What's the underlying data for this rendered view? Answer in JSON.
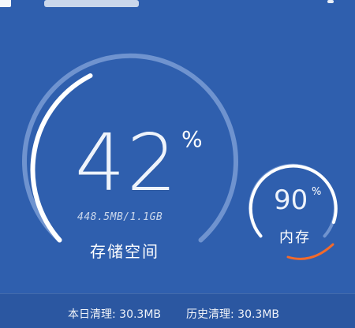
{
  "topbar": {
    "title": "",
    "menu_icon": "more-icon"
  },
  "storage": {
    "percent_value": "42",
    "percent_sign": "%",
    "usage_text": "448.5MB/1.1GB",
    "label": "存储空间",
    "used_fraction": 0.42
  },
  "memory": {
    "percent_value": "90",
    "percent_sign": "%",
    "label": "内存",
    "used_fraction": 0.9
  },
  "footer": {
    "today_text": "本日清理: 30.3MB",
    "history_text": "历史清理: 30.3MB"
  },
  "colors": {
    "background": "#2f5fae",
    "track": "#6f93cf",
    "fill": "#ffffff",
    "accent": "#f26a2b"
  }
}
